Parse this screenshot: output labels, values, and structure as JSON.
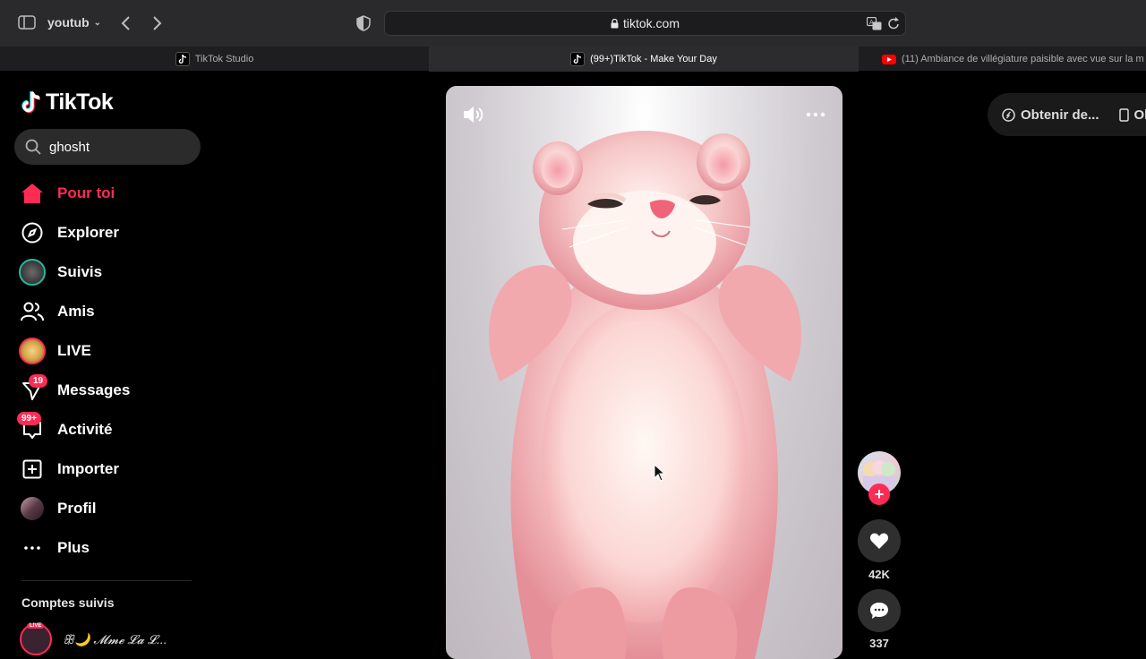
{
  "browser": {
    "profile_name": "youtub",
    "url": "tiktok.com",
    "tabs": [
      {
        "label": "TikTok Studio",
        "favicon": "tiktok-icon",
        "active": false
      },
      {
        "label": "(99+)TikTok - Make Your Day",
        "favicon": "tiktok-icon",
        "active": true
      },
      {
        "label": "(11) Ambiance de villégiature paisible avec vue sur la m",
        "favicon": "youtube-icon",
        "active": false
      }
    ]
  },
  "sidebar": {
    "logo_text": "TikTok",
    "search_value": "ghosht",
    "nav": [
      {
        "label": "Pour toi",
        "icon": "home-icon",
        "active": true
      },
      {
        "label": "Explorer",
        "icon": "compass-icon"
      },
      {
        "label": "Suivis",
        "icon": "following-avatar-icon"
      },
      {
        "label": "Amis",
        "icon": "friends-icon"
      },
      {
        "label": "LIVE",
        "icon": "live-icon"
      },
      {
        "label": "Messages",
        "icon": "messages-icon",
        "badge": "19"
      },
      {
        "label": "Activité",
        "icon": "inbox-icon",
        "badge": "99+"
      },
      {
        "label": "Importer",
        "icon": "upload-icon"
      },
      {
        "label": "Profil",
        "icon": "profile-avatar"
      },
      {
        "label": "Plus",
        "icon": "more-icon"
      }
    ],
    "following_title": "Comptes suivis",
    "followed_accounts": [
      {
        "name": "ꕥ🌙 𝓜𝓶𝓮 𝓛𝓪 𝓛...",
        "live_label": "LIVE"
      }
    ]
  },
  "video": {
    "sound_icon": "volume-icon",
    "more_icon": "ellipsis-icon"
  },
  "actions": {
    "likes": "42K",
    "comments": "337"
  },
  "top_right": {
    "item1": "Obtenir de...",
    "item2": "Obt"
  },
  "colors": {
    "accent": "#fe2c55",
    "background": "#000000",
    "chrome": "#2a2a2c"
  }
}
